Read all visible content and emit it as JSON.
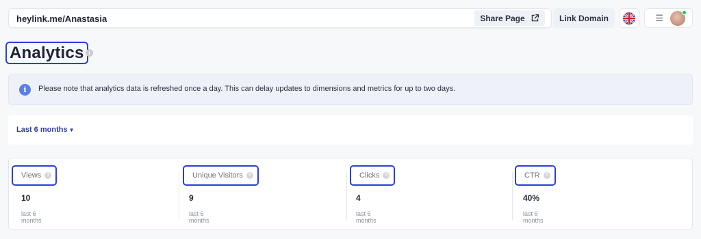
{
  "header": {
    "url": "heylink.me/Anastasia",
    "share_label": "Share Page",
    "link_domain_label": "Link Domain"
  },
  "page": {
    "title": "Analytics"
  },
  "notice": {
    "text": "Please note that analytics data is refreshed once a day. This can delay updates to dimensions and metrics for up to two days."
  },
  "period": {
    "selected": "Last 6 months"
  },
  "stats": [
    {
      "label": "Views",
      "value": "10",
      "period": "last 6 months"
    },
    {
      "label": "Unique Visitors",
      "value": "9",
      "period": "last 6 months"
    },
    {
      "label": "Clicks",
      "value": "4",
      "period": "last 6 months"
    },
    {
      "label": "CTR",
      "value": "40%",
      "period": "last 6 months"
    }
  ],
  "colors": {
    "accent": "#2b3fd1",
    "info": "#5b7fde",
    "status_online": "#22c55e"
  }
}
